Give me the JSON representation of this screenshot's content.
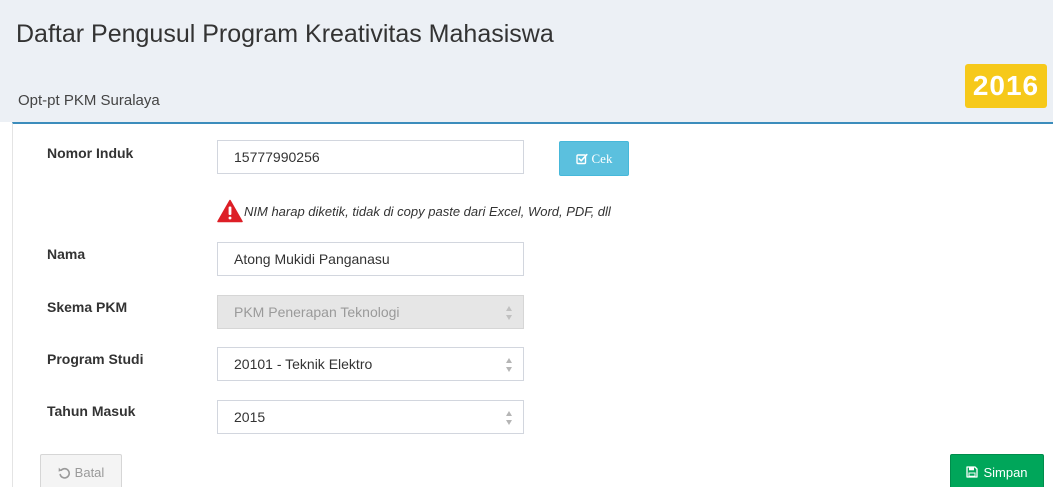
{
  "header": {
    "title": "Daftar Pengusul Program Kreativitas Mahasiswa",
    "box_title": "Opt-pt PKM Suralaya",
    "year_badge": "2016"
  },
  "form": {
    "nomor_induk": {
      "label": "Nomor Induk",
      "value": "15777990256"
    },
    "cek_button": {
      "label": "Cek",
      "icon": "check-square-icon"
    },
    "warning": {
      "icon": "warning-triangle-icon",
      "text": "NIM harap diketik, tidak di copy paste dari Excel, Word, PDF, dll"
    },
    "nama": {
      "label": "Nama",
      "value": "Atong Mukidi Panganasu"
    },
    "skema_pkm": {
      "label": "Skema PKM",
      "value": "PKM Penerapan Teknologi"
    },
    "program_studi": {
      "label": "Program Studi",
      "value": "20101 - Teknik Elektro"
    },
    "tahun_masuk": {
      "label": "Tahun Masuk",
      "value": "2015"
    }
  },
  "actions": {
    "batal_label": "Batal",
    "simpan_label": "Simpan"
  },
  "colors": {
    "accent_blue": "#3c8dbc",
    "info_button": "#5bc0de",
    "success_button": "#00a65a",
    "badge_yellow": "#f6c91a",
    "warning_red": "#dd1f26"
  }
}
